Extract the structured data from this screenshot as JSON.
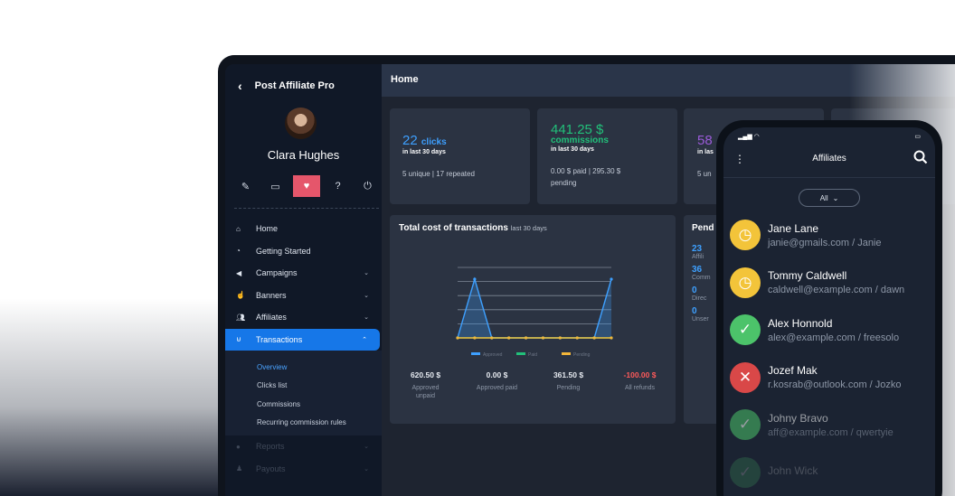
{
  "app": {
    "title": "Post Affiliate Pro",
    "back": "‹"
  },
  "user": {
    "name": "Clara Hughes"
  },
  "toolbar": [
    {
      "icon": "pencil-icon",
      "glyph": "✎"
    },
    {
      "icon": "monitor-icon",
      "glyph": "▭"
    },
    {
      "icon": "heart-rate-icon",
      "glyph": "♥"
    },
    {
      "icon": "help-icon",
      "glyph": "?"
    },
    {
      "icon": "power-icon",
      "glyph": "⏻"
    }
  ],
  "nav": {
    "home": "Home",
    "getting_started": "Getting Started",
    "campaigns": "Campaigns",
    "banners": "Banners",
    "affiliates": "Affiliates",
    "transactions": "Transactions",
    "sub": [
      "Overview",
      "Clicks list",
      "Commissions",
      "Recurring commission rules"
    ],
    "reports": "Reports",
    "payouts": "Payouts"
  },
  "page": {
    "title": "Home"
  },
  "stats": {
    "clicks": {
      "value": "22",
      "unit": "clicks",
      "period": "in last 30 days",
      "foot": "5 unique | 17 repeated",
      "color": "#3ea0ff"
    },
    "commissions": {
      "value": "441.25 $",
      "unit": "commissions",
      "period": "in last 30 days",
      "foot1": "0.00 $ paid | 295.30 $",
      "foot2": "pending",
      "color": "#22c07a"
    },
    "third": {
      "value": "58",
      "period": "in las",
      "foot": "5 un",
      "color": "#9a5bd8"
    }
  },
  "chart_data": {
    "type": "area",
    "title": "Total cost of transactions",
    "subtitle": "last 30 days",
    "ylim": [
      0,
      120
    ],
    "series": [
      {
        "name": "Approved",
        "color": "#3ea0ff",
        "values": [
          0,
          100,
          0,
          0,
          0,
          0,
          0,
          0,
          0,
          100
        ]
      },
      {
        "name": "Paid",
        "color": "#22c07a",
        "values": [
          0,
          0,
          0,
          0,
          0,
          0,
          0,
          0,
          0,
          0
        ]
      },
      {
        "name": "Pending",
        "color": "#f3b63a",
        "values": [
          0,
          0,
          0,
          0,
          0,
          0,
          0,
          0,
          0,
          0
        ]
      }
    ],
    "grid": true,
    "legend": "bottom"
  },
  "totals": [
    {
      "value": "620.50 $",
      "label": "Approved unpaid",
      "color": "#e6eaf0"
    },
    {
      "value": "0.00 $",
      "label": "Approved paid",
      "color": "#e6eaf0"
    },
    {
      "value": "361.50 $",
      "label": "Pending",
      "color": "#e6eaf0"
    },
    {
      "value": "-100.00 $",
      "label": "All refunds",
      "color": "#ff5a5a"
    }
  ],
  "pending": {
    "title": "Pend",
    "items": [
      {
        "value": "23",
        "label": "Affili"
      },
      {
        "value": "36",
        "label": "Comm"
      },
      {
        "value": "0",
        "label": "Direc"
      },
      {
        "value": "0",
        "label": "Unser"
      }
    ]
  },
  "phone": {
    "title": "Affiliates",
    "filter": "All",
    "affiliates": [
      {
        "name": "Jane Lane",
        "email": "janie@gmails.com / Janie",
        "status": "pending",
        "color": "#f3c43a",
        "glyph": "◷"
      },
      {
        "name": "Tommy Caldwell",
        "email": "caldwell@example.com / dawn",
        "status": "pending",
        "color": "#f3c43a",
        "glyph": "◷"
      },
      {
        "name": "Alex Honnold",
        "email": "alex@example.com / freesolo",
        "status": "approved",
        "color": "#4cc36a",
        "glyph": "✓"
      },
      {
        "name": "Jozef Mak",
        "email": "r.kosrab@outlook.com / Jozko",
        "status": "declined",
        "color": "#d94848",
        "glyph": "✕"
      },
      {
        "name": "Johny Bravo",
        "email": "aff@example.com / qwertyie",
        "status": "approved",
        "color": "#4cc36a",
        "glyph": "✓"
      },
      {
        "name": "John Wick",
        "email": "",
        "status": "approved",
        "color": "#4cc36a",
        "glyph": "✓"
      }
    ]
  }
}
